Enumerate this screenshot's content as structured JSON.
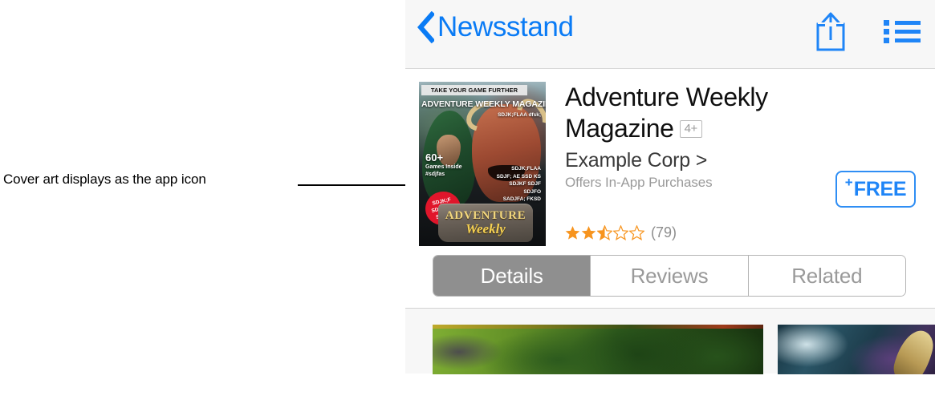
{
  "annotation": {
    "text": "Cover art displays as the app icon"
  },
  "navbar": {
    "back_label": "Newsstand",
    "back_icon": "chevron-left-icon",
    "share_icon": "share-upload-icon",
    "list_icon": "bulleted-list-icon"
  },
  "app": {
    "title": "Adventure Weekly Magazine",
    "age_rating": "4+",
    "developer": "Example Corp >",
    "in_app_purchases": "Offers In-App Purchases",
    "rating_stars": 2.5,
    "rating_count": "(79)",
    "price_label": "FREE",
    "price_plus": "+",
    "accent_color": "#1f85f7",
    "star_color": "#f7941e"
  },
  "cover": {
    "banner": "TAKE YOUR GAME FURTHER",
    "title": "ADVENTURE WEEKLY MAGAZINE",
    "subtitle": "SDJK;FLAA dfsk;",
    "callout_big": "60+",
    "callout_line1": "Games Inside",
    "callout_line2": "#sdjfas",
    "right_lines": [
      "SDJK;FLAA",
      "SDJF; AE  SSD KS",
      "SDJKF SDJF",
      "SDJFO",
      "SADJFA; FKSD"
    ],
    "burst_lines": [
      "SDJK;F",
      "SDJF; AE",
      "SDJFO"
    ],
    "logo_line1": "ADVENTURE",
    "logo_line2": "Weekly"
  },
  "tabs": {
    "items": [
      {
        "label": "Details",
        "active": true
      },
      {
        "label": "Reviews",
        "active": false
      },
      {
        "label": "Related",
        "active": false
      }
    ]
  },
  "screenshots": {
    "items": [
      {
        "name": "screenshot-jungle"
      },
      {
        "name": "screenshot-character"
      }
    ]
  }
}
